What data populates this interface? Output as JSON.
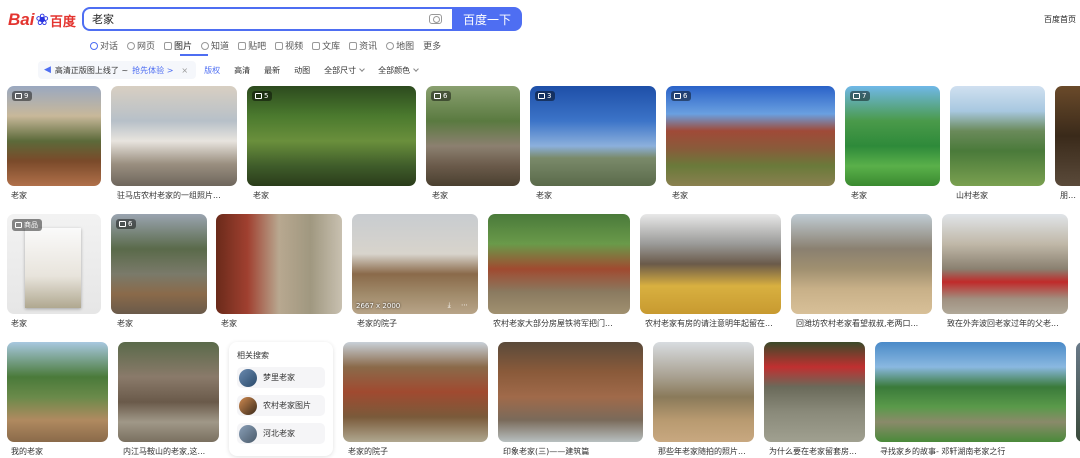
{
  "logo": {
    "left": "Bai",
    "right": "百度"
  },
  "search": {
    "value": "老家",
    "button": "百度一下"
  },
  "home_link": "百度首页",
  "tabs": [
    "对话",
    "网页",
    "图片",
    "知道",
    "贴吧",
    "视频",
    "文库",
    "资讯",
    "地图",
    "更多"
  ],
  "banner": {
    "text": "高清正版图上线了 ~",
    "cta": "抢先体验 >"
  },
  "filters": [
    "版权",
    "高清",
    "最新",
    "动图",
    "全部尺寸",
    "全部颜色"
  ],
  "results": [
    {
      "caption": "老家",
      "count": "9"
    },
    {
      "caption": "驻马店农村老家的一组照片..."
    },
    {
      "caption": "老家",
      "count": "5"
    },
    {
      "caption": "老家",
      "count": "6"
    },
    {
      "caption": "老家",
      "count": "3"
    },
    {
      "caption": "老家",
      "count": "6"
    },
    {
      "caption": "老家",
      "count": "7"
    },
    {
      "caption": "山村老家"
    },
    {
      "caption": "朋友跟"
    },
    {
      "caption": "老家",
      "badge": "商品"
    },
    {
      "caption": "老家",
      "count": "6"
    },
    {
      "caption": "老家"
    },
    {
      "caption": "老家的院子",
      "dims": "2667 x 2000"
    },
    {
      "caption": "农村老家大部分房屋铁将军把门..."
    },
    {
      "caption": "农村老家有房的请注意明年起留在..."
    },
    {
      "caption": "回潍坊农村老家看望叔叔,老两口..."
    },
    {
      "caption": "致在外奔波回老家过年的父老..."
    },
    {
      "caption": "我的老家"
    },
    {
      "caption": "内江马鞍山的老家,这..."
    },
    {
      "caption": "老家的院子"
    },
    {
      "caption": "印象老家(三)——建筑篇"
    },
    {
      "caption": "那些年老家随拍的照片..."
    },
    {
      "caption": "为什么要在老家留套房..."
    },
    {
      "caption": "寻找家乡的故事- 邓轩湖南老家之行"
    }
  ],
  "related": {
    "title": "相关搜索",
    "items": [
      "梦里老家",
      "农村老家图片",
      "河北老家"
    ]
  }
}
